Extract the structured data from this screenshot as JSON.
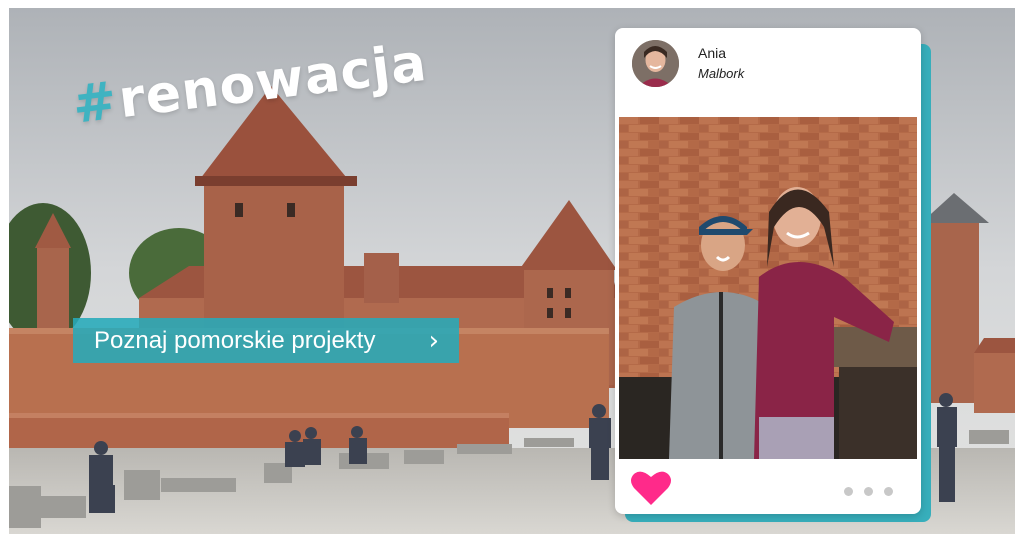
{
  "hero": {
    "hashtag_symbol": "#",
    "hashtag_word": "renowacja"
  },
  "cta": {
    "label": "Poznaj pomorskie projekty",
    "icon": "chevron-right-icon"
  },
  "post_card": {
    "user_name": "Ania",
    "location": "Malbork",
    "like_icon": "heart-icon",
    "more_icon": "more-dots-icon"
  },
  "colors": {
    "accent_teal": "#27aab9",
    "heart_pink": "#ff2a8a",
    "brick": "#b86a4d"
  }
}
